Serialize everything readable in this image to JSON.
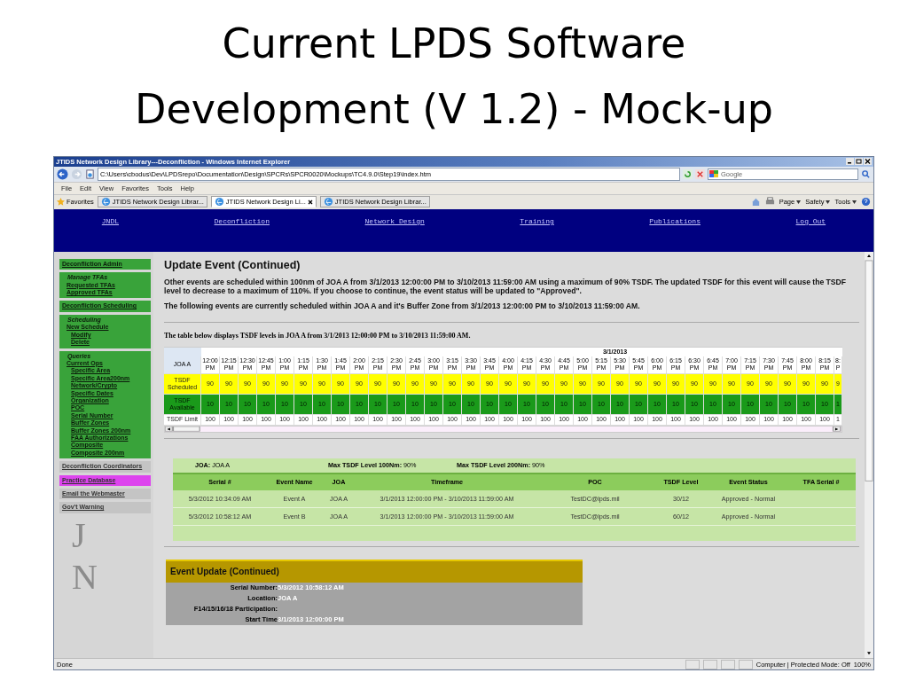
{
  "slide": {
    "title_lines": [
      "Current LPDS Software",
      "Development (V 1.2) - Mock-up"
    ]
  },
  "browser": {
    "title": "JTIDS Network Design Library---Deconfliction - Windows Internet Explorer",
    "address": "C:\\Users\\cbodus\\Dev\\LPDSrepo\\Documentation\\Design\\SPCRs\\SPCR0020\\Mockups\\TC4.9.0\\Step19\\index.htm",
    "search_placeholder": "Google",
    "menu": [
      "File",
      "Edit",
      "View",
      "Favorites",
      "Tools",
      "Help"
    ],
    "favorites_label": "Favorites",
    "tabs": [
      {
        "label": "JTIDS Network Design Librar...",
        "selected": false
      },
      {
        "label": "JTIDS Network Design Li...",
        "selected": true
      },
      {
        "label": "JTIDS Network Design Librar...",
        "selected": false
      }
    ],
    "commands": [
      "Page",
      "Safety",
      "Tools"
    ]
  },
  "nav": [
    "JNDL",
    "Deconfliction",
    "Network Design",
    "Training",
    "Publications",
    "Log Out"
  ],
  "sidebar": {
    "items": [
      {
        "kind": "section",
        "label": "Deconfliction Admin"
      },
      {
        "kind": "group",
        "title": "Manage TFAs",
        "children": [
          {
            "label": "Requested TFAs"
          },
          {
            "label": "Approved TFAs"
          }
        ]
      },
      {
        "kind": "section",
        "label": "Deconfliction Scheduling"
      },
      {
        "kind": "group",
        "title": "Scheduling",
        "children": [
          {
            "label": "New Schedule",
            "children": [
              {
                "label": "Modify"
              },
              {
                "label": "Delete"
              }
            ]
          }
        ]
      },
      {
        "kind": "group",
        "title": "Queries",
        "children": [
          {
            "label": "Current Ops",
            "children": [
              {
                "label": "Specific Area"
              },
              {
                "label": "Specific Area200nm"
              },
              {
                "label": "Network/Crypto"
              },
              {
                "label": "Specific Dates"
              },
              {
                "label": "Organization"
              },
              {
                "label": "POC"
              },
              {
                "label": "Serial Number"
              },
              {
                "label": "Buffer Zones"
              },
              {
                "label": "Buffer Zones 200nm"
              },
              {
                "label": "FAA Authorizations"
              },
              {
                "label": "Composite"
              },
              {
                "label": "Composite 200nm"
              }
            ]
          }
        ]
      },
      {
        "kind": "link",
        "label": "Deconfliction Coordinators"
      },
      {
        "kind": "highlight",
        "label": "Practice Database"
      },
      {
        "kind": "link",
        "label": "Email the Webmaster"
      },
      {
        "kind": "link",
        "label": "Gov't Warning"
      }
    ],
    "logo_letters": [
      "J",
      "N"
    ]
  },
  "main": {
    "heading": "Update Event (Continued)",
    "paragraphs": [
      "Other events are scheduled within 100nm of JOA A from 3/1/2013 12:00:00 PM to 3/10/2013 11:59:00 AM using a maximum of 90% TSDF. The updated TSDF for this event will cause the TSDF level to decrease to a maximum of 110%. If you choose to continue, the event status will be updated to \"Approved\".",
      "The following events are currently scheduled within JOA A and it's Buffer Zone from 3/1/2013 12:00:00 PM to 3/10/2013 11:59:00 AM."
    ],
    "table_caption": "The table below displays TSDF levels in JOA A from 3/1/2013 12:00:00 PM to 3/10/2013 11:59:00 AM.",
    "timeline": {
      "date": "3/1/2013",
      "corner": "JOA A",
      "columns": [
        {
          "time": "12:00",
          "period": "PM"
        },
        {
          "time": "12:15",
          "period": "PM"
        },
        {
          "time": "12:30",
          "period": "PM"
        },
        {
          "time": "12:45",
          "period": "PM"
        },
        {
          "time": "1:00",
          "period": "PM"
        },
        {
          "time": "1:15",
          "period": "PM"
        },
        {
          "time": "1:30",
          "period": "PM"
        },
        {
          "time": "1:45",
          "period": "PM"
        },
        {
          "time": "2:00",
          "period": "PM"
        },
        {
          "time": "2:15",
          "period": "PM"
        },
        {
          "time": "2:30",
          "period": "PM"
        },
        {
          "time": "2:45",
          "period": "PM"
        },
        {
          "time": "3:00",
          "period": "PM"
        },
        {
          "time": "3:15",
          "period": "PM"
        },
        {
          "time": "3:30",
          "period": "PM"
        },
        {
          "time": "3:45",
          "period": "PM"
        },
        {
          "time": "4:00",
          "period": "PM"
        },
        {
          "time": "4:15",
          "period": "PM"
        },
        {
          "time": "4:30",
          "period": "PM"
        },
        {
          "time": "4:45",
          "period": "PM"
        },
        {
          "time": "5:00",
          "period": "PM"
        },
        {
          "time": "5:15",
          "period": "PM"
        },
        {
          "time": "5:30",
          "period": "PM"
        },
        {
          "time": "5:45",
          "period": "PM"
        },
        {
          "time": "6:00",
          "period": "PM"
        },
        {
          "time": "6:15",
          "period": "PM"
        },
        {
          "time": "6:30",
          "period": "PM"
        },
        {
          "time": "6:45",
          "period": "PM"
        },
        {
          "time": "7:00",
          "period": "PM"
        },
        {
          "time": "7:15",
          "period": "PM"
        },
        {
          "time": "7:30",
          "period": "PM"
        },
        {
          "time": "7:45",
          "period": "PM"
        },
        {
          "time": "8:00",
          "period": "PM"
        },
        {
          "time": "8:15",
          "period": "PM"
        },
        {
          "time": "8:",
          "period": "P"
        }
      ],
      "rows": [
        {
          "kind": "scheduled",
          "label": "TSDF Scheduled",
          "values": [
            "90",
            "90",
            "90",
            "90",
            "90",
            "90",
            "90",
            "90",
            "90",
            "90",
            "90",
            "90",
            "90",
            "90",
            "90",
            "90",
            "90",
            "90",
            "90",
            "90",
            "90",
            "90",
            "90",
            "90",
            "90",
            "90",
            "90",
            "90",
            "90",
            "90",
            "90",
            "90",
            "90",
            "90",
            "9"
          ]
        },
        {
          "kind": "available",
          "label": "TSDF Available",
          "values": [
            "10",
            "10",
            "10",
            "10",
            "10",
            "10",
            "10",
            "10",
            "10",
            "10",
            "10",
            "10",
            "10",
            "10",
            "10",
            "10",
            "10",
            "10",
            "10",
            "10",
            "10",
            "10",
            "10",
            "10",
            "10",
            "10",
            "10",
            "10",
            "10",
            "10",
            "10",
            "10",
            "10",
            "10",
            "1"
          ]
        },
        {
          "kind": "limit",
          "label": "TSDF Limit",
          "values": [
            "100",
            "100",
            "100",
            "100",
            "100",
            "100",
            "100",
            "100",
            "100",
            "100",
            "100",
            "100",
            "100",
            "100",
            "100",
            "100",
            "100",
            "100",
            "100",
            "100",
            "100",
            "100",
            "100",
            "100",
            "100",
            "100",
            "100",
            "100",
            "100",
            "100",
            "100",
            "100",
            "100",
            "100",
            "1"
          ]
        }
      ]
    },
    "events": {
      "summary": [
        {
          "label": "JOA:",
          "value": "JOA A"
        },
        {
          "label": "Max TSDF Level 100Nm:",
          "value": "90%"
        },
        {
          "label": "Max TSDF Level 200Nm:",
          "value": "90%"
        }
      ],
      "columns": [
        "Serial #",
        "Event Name",
        "JOA",
        "Timeframe",
        "POC",
        "TSDF Level",
        "Event Status",
        "TFA Serial #"
      ],
      "rows": [
        [
          "5/3/2012 10:34:09 AM",
          "Event A",
          "JOA A",
          "3/1/2013 12:00:00 PM  - 3/10/2013 11:59:00 AM",
          "TestDC@lpds.mil",
          "30/12",
          "Approved - Normal"
        ],
        [
          "5/3/2012 10:58:12 AM",
          "Event B",
          "JOA A",
          "3/1/2013 12:00:00 PM - 3/10/2013 11:59:00 AM",
          "TestDC@lpds.mil",
          "60/12",
          "Approved - Normal"
        ]
      ]
    },
    "update": {
      "title": "Event Update (Continued)",
      "fields": [
        {
          "label": "Serial Number:",
          "value": "5/3/2012 10:58:12 AM"
        },
        {
          "label": "Location:",
          "value": "JOA A"
        },
        {
          "label": "F14/15/16/18 Participation:"
        },
        {
          "label": "Start Time",
          "value": "3/1/2013 12:00:00 PM"
        }
      ]
    }
  },
  "status": {
    "text": "Done",
    "zone": "Computer | Protected Mode: Off",
    "zoom": "100%"
  }
}
